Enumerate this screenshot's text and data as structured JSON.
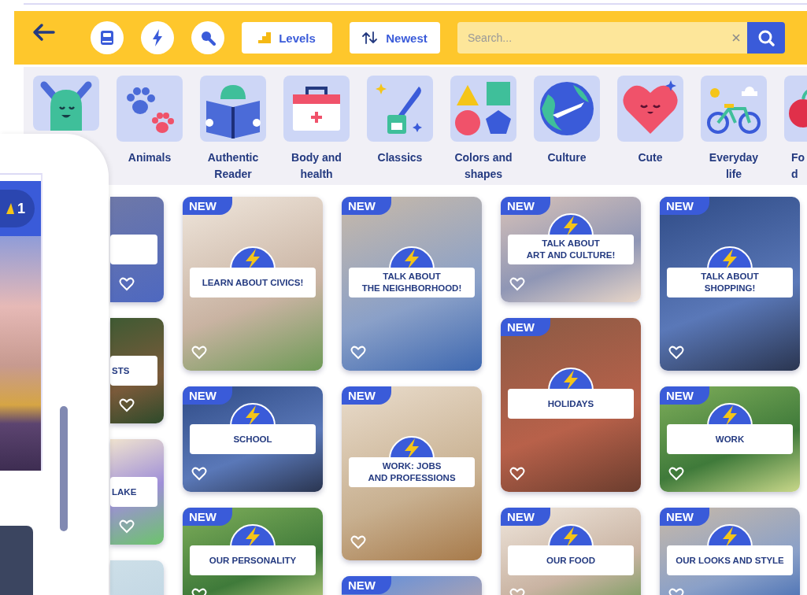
{
  "toolbar": {
    "levels_button": "Levels",
    "sort_button": "Newest",
    "search": {
      "placeholder": "Search..."
    }
  },
  "categories": [
    {
      "kind": "monster"
    },
    {
      "kind": "paws",
      "label": "Animals"
    },
    {
      "kind": "book",
      "label": "Authentic\nReader"
    },
    {
      "kind": "medkit",
      "label": "Body and\nhealth"
    },
    {
      "kind": "ink",
      "label": "Classics"
    },
    {
      "kind": "shapes",
      "label": "Colors and\nshapes"
    },
    {
      "kind": "globe",
      "label": "Culture"
    },
    {
      "kind": "heart",
      "label": "Cute"
    },
    {
      "kind": "bike",
      "label": "Everyday\nlife"
    },
    {
      "kind": "fruit",
      "label": "Fo\nd"
    }
  ],
  "preview_panel": {
    "level_badge": "1"
  },
  "columns": [
    [
      {
        "kind": "short"
      },
      {
        "kind": "short",
        "title": "STS"
      },
      {
        "kind": "short",
        "title": "LAKE"
      },
      {
        "kind": "short"
      }
    ],
    [
      {
        "kind": "tall",
        "badge": "NEW",
        "title": "LEARN ABOUT CIVICS!"
      },
      {
        "kind": "short",
        "badge": "NEW",
        "title": "SCHOOL"
      },
      {
        "kind": "short",
        "badge": "NEW",
        "title": "OUR PERSONALITY"
      }
    ],
    [
      {
        "kind": "tall",
        "badge": "NEW",
        "title": "TALK ABOUT\nTHE NEIGHBORHOOD!"
      },
      {
        "kind": "tall",
        "badge": "NEW",
        "title": "WORK: JOBS\nAND PROFESSIONS"
      },
      {
        "kind": "tall",
        "badge": "NEW"
      }
    ],
    [
      {
        "kind": "short",
        "badge": "NEW",
        "title": "TALK ABOUT\nART AND CULTURE!"
      },
      {
        "kind": "tall",
        "badge": "NEW",
        "title": "HOLIDAYS"
      },
      {
        "kind": "short",
        "badge": "NEW",
        "title": "OUR FOOD"
      }
    ],
    [
      {
        "kind": "tall",
        "badge": "NEW",
        "title": "TALK ABOUT\nSHOPPING!"
      },
      {
        "kind": "short",
        "badge": "NEW",
        "title": "WORK"
      },
      {
        "kind": "short",
        "badge": "NEW",
        "title": "OUR LOOKS AND STYLE"
      }
    ]
  ]
}
